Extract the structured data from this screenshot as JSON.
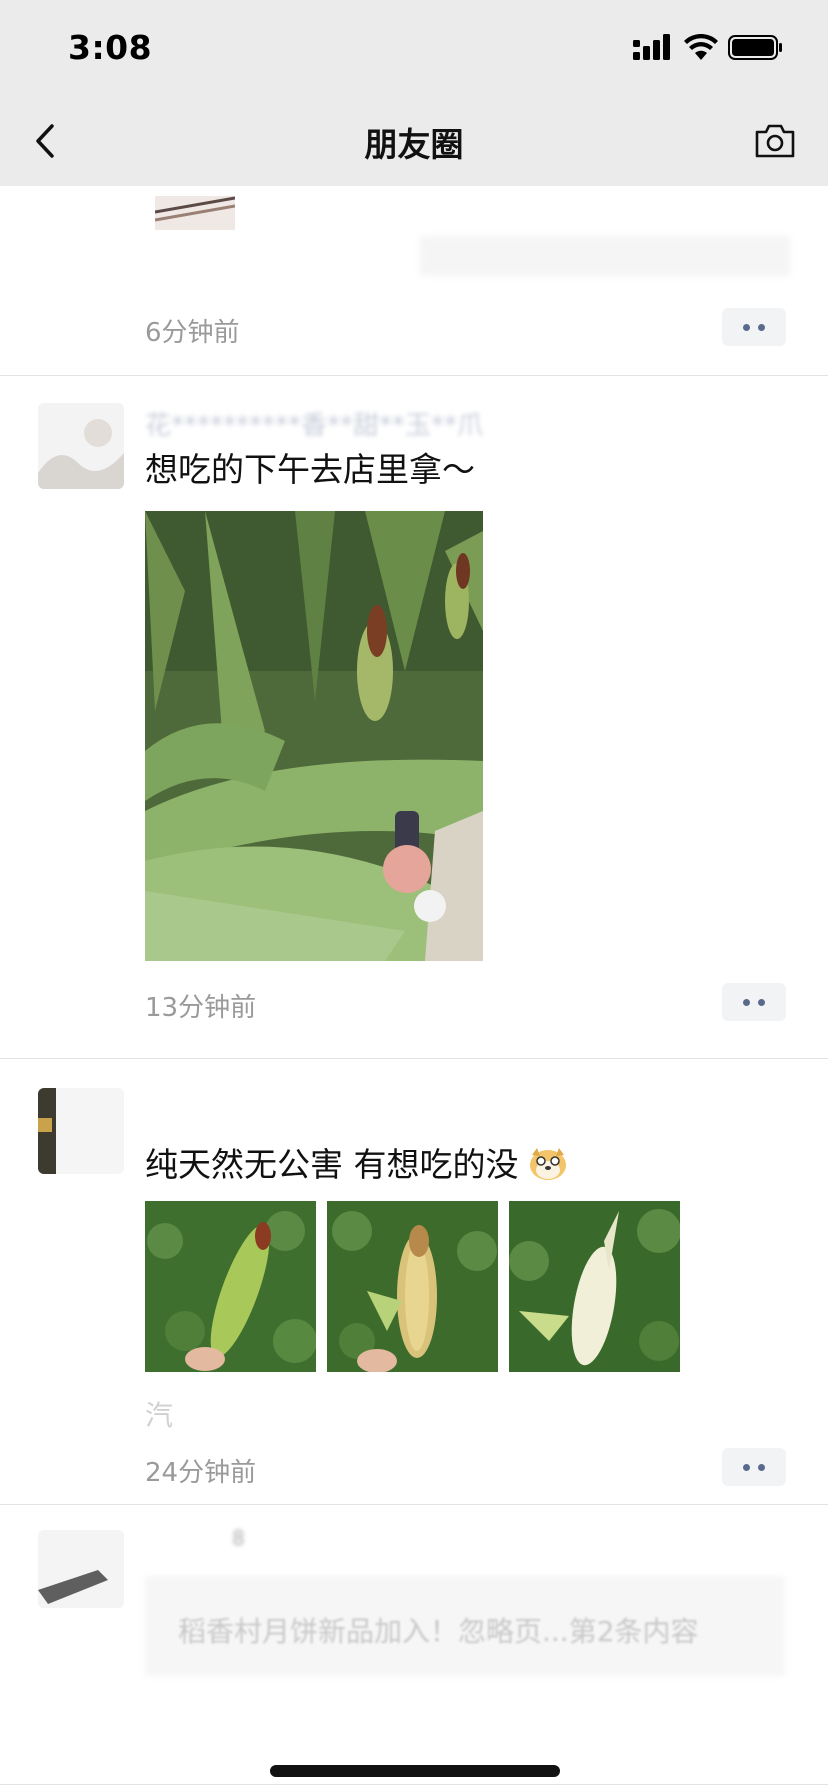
{
  "status_bar": {
    "time": "3:08"
  },
  "nav": {
    "title": "朋友圈"
  },
  "posts": [
    {
      "time_ago": "6分钟前"
    },
    {
      "username": "花**********香**甜**玉**爪",
      "text": "想吃的下午去店里拿～",
      "time_ago": "13分钟前"
    },
    {
      "username": "",
      "text": "纯天然无公害 有想吃的没",
      "emoji": "dog-emoji",
      "extra": "汽",
      "time_ago": "24分钟前"
    },
    {
      "username": "8",
      "ad_text": "稻香村月饼新品加入！忽略页...第2条内容"
    }
  ],
  "icons": [
    "back-icon",
    "camera-icon",
    "signal-icon",
    "wifi-icon",
    "battery-icon",
    "more-icon"
  ]
}
